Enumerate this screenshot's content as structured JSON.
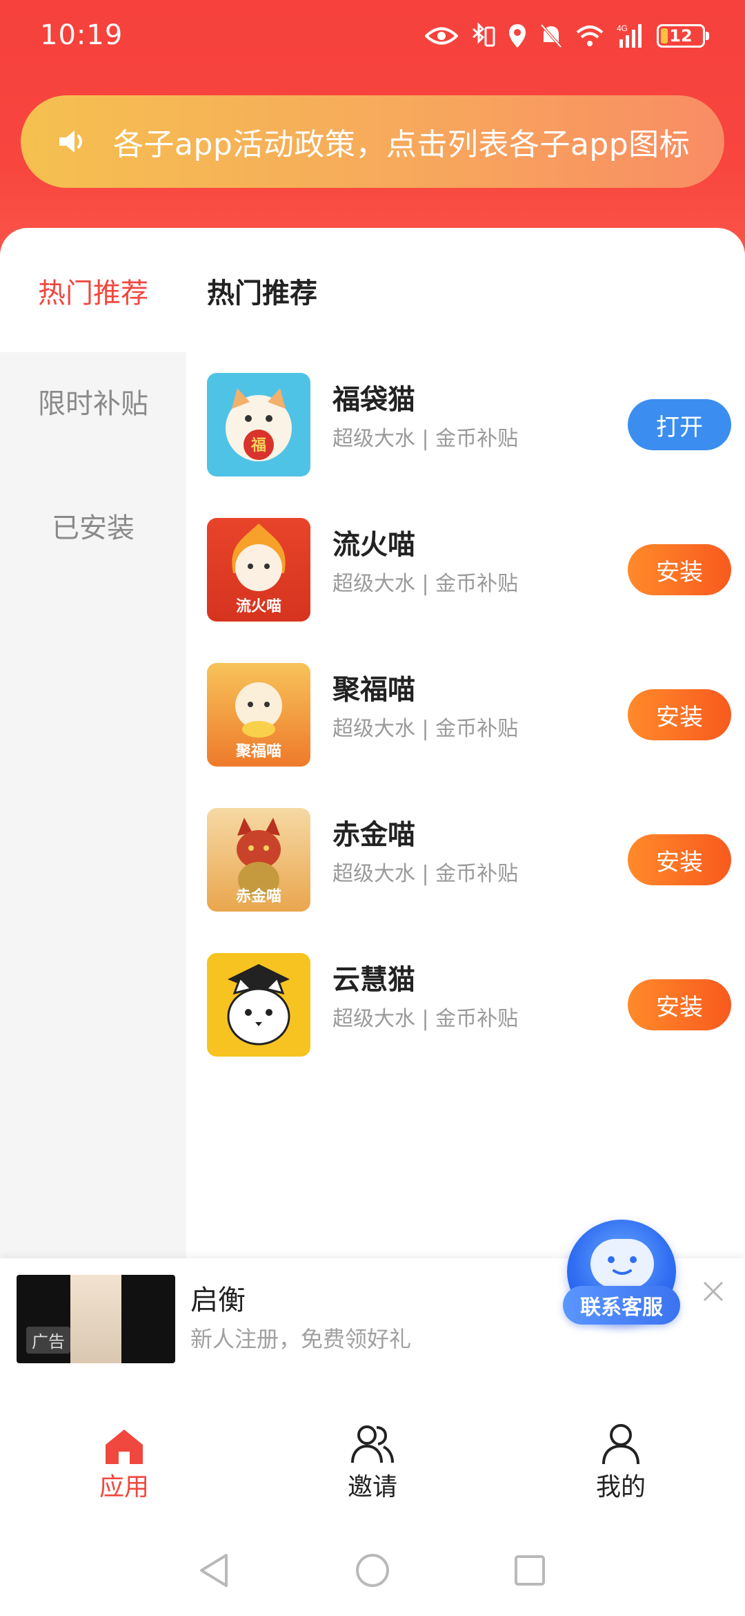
{
  "status": {
    "time": "10:19",
    "battery": "12",
    "network": "4G"
  },
  "notice": {
    "text": "各子app活动政策，点击列表各子app图标"
  },
  "sidebar": {
    "active": "热门推荐",
    "items": [
      {
        "label": "限时补贴"
      },
      {
        "label": "已安装"
      }
    ]
  },
  "section": {
    "title": "热门推荐"
  },
  "apps": [
    {
      "name": "福袋猫",
      "subtitle": "超级大水 | 金币补贴",
      "button": "打开",
      "icon_label": "福"
    },
    {
      "name": "流火喵",
      "subtitle": "超级大水 | 金币补贴",
      "button": "安装",
      "icon_label": "流火喵"
    },
    {
      "name": "聚福喵",
      "subtitle": "超级大水 | 金币补贴",
      "button": "安装",
      "icon_label": "聚福喵"
    },
    {
      "name": "赤金喵",
      "subtitle": "超级大水 | 金币补贴",
      "button": "安装",
      "icon_label": "赤金喵"
    },
    {
      "name": "云慧猫",
      "subtitle": "超级大水 | 金币补贴",
      "button": "安装",
      "icon_label": ""
    }
  ],
  "ad": {
    "title": "启衡",
    "subtitle": "新人注册，免费领好礼",
    "badge": "广告"
  },
  "support": {
    "label": "联系客服"
  },
  "nav": {
    "items": [
      {
        "label": "应用"
      },
      {
        "label": "邀请"
      },
      {
        "label": "我的"
      }
    ]
  },
  "colors": {
    "brand_red": "#f6413c",
    "install_orange": "#f8661f",
    "open_blue": "#3b8ef0"
  }
}
